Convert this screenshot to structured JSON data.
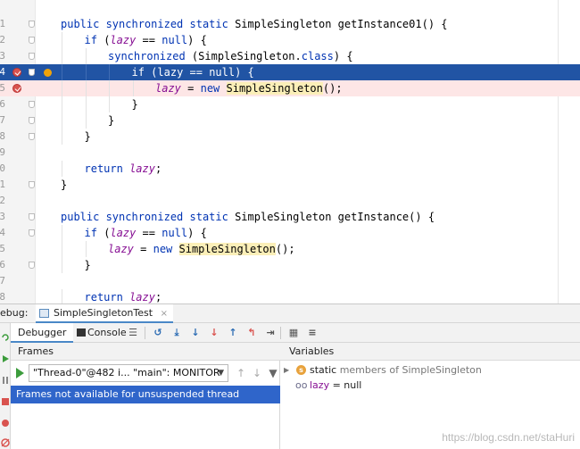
{
  "editor": {
    "lines": [
      {
        "num": "1",
        "tokens": [
          {
            "t": "public ",
            "c": "kw"
          },
          {
            "t": "synchronized ",
            "c": "kw"
          },
          {
            "t": "static ",
            "c": "kw"
          },
          {
            "t": "SimpleSingleton getInstance01() {",
            "c": ""
          }
        ]
      },
      {
        "num": "2",
        "tokens": [
          {
            "t": "if ",
            "c": "kw"
          },
          {
            "t": "(",
            "c": ""
          },
          {
            "t": "lazy",
            "c": "fld"
          },
          {
            "t": " == ",
            "c": ""
          },
          {
            "t": "null",
            "c": "nul"
          },
          {
            "t": ") {",
            "c": ""
          }
        ]
      },
      {
        "num": "3",
        "tokens": [
          {
            "t": "synchronized ",
            "c": "kw"
          },
          {
            "t": "(SimpleSingleton.",
            "c": ""
          },
          {
            "t": "class",
            "c": "kw"
          },
          {
            "t": ") {",
            "c": ""
          }
        ]
      },
      {
        "num": "4",
        "tokens": [
          {
            "t": "if (lazy == null) {",
            "c": ""
          }
        ]
      },
      {
        "num": "5",
        "tokens": [
          {
            "t": "lazy",
            "c": "fld"
          },
          {
            "t": " = ",
            "c": ""
          },
          {
            "t": "new ",
            "c": "kw"
          },
          {
            "t": "SimpleSingleton",
            "c": "cls"
          },
          {
            "t": "();",
            "c": ""
          }
        ]
      },
      {
        "num": "6",
        "tokens": [
          {
            "t": "}",
            "c": ""
          }
        ]
      },
      {
        "num": "7",
        "tokens": [
          {
            "t": "}",
            "c": ""
          }
        ]
      },
      {
        "num": "8",
        "tokens": [
          {
            "t": "}",
            "c": ""
          }
        ]
      },
      {
        "num": "9",
        "tokens": []
      },
      {
        "num": "0",
        "tokens": [
          {
            "t": "return ",
            "c": "kw"
          },
          {
            "t": "lazy",
            "c": "fld"
          },
          {
            "t": ";",
            "c": ""
          }
        ]
      },
      {
        "num": "1",
        "tokens": [
          {
            "t": "}",
            "c": ""
          }
        ]
      },
      {
        "num": "2",
        "tokens": []
      },
      {
        "num": "3",
        "tokens": [
          {
            "t": "public ",
            "c": "kw"
          },
          {
            "t": "synchronized ",
            "c": "kw"
          },
          {
            "t": "static ",
            "c": "kw"
          },
          {
            "t": "SimpleSingleton getInstance() {",
            "c": ""
          }
        ]
      },
      {
        "num": "4",
        "tokens": [
          {
            "t": "if ",
            "c": "kw"
          },
          {
            "t": "(",
            "c": ""
          },
          {
            "t": "lazy",
            "c": "fld"
          },
          {
            "t": " == ",
            "c": ""
          },
          {
            "t": "null",
            "c": "nul"
          },
          {
            "t": ") {",
            "c": ""
          }
        ]
      },
      {
        "num": "5",
        "tokens": [
          {
            "t": "lazy",
            "c": "fld"
          },
          {
            "t": " = ",
            "c": ""
          },
          {
            "t": "new ",
            "c": "kw"
          },
          {
            "t": "SimpleSingleton",
            "c": "cls"
          },
          {
            "t": "();",
            "c": ""
          }
        ]
      },
      {
        "num": "6",
        "tokens": [
          {
            "t": "}",
            "c": ""
          }
        ]
      },
      {
        "num": "7",
        "tokens": []
      },
      {
        "num": "8",
        "tokens": [
          {
            "t": "return ",
            "c": "kw"
          },
          {
            "t": "lazy",
            "c": "fld"
          },
          {
            "t": ";",
            "c": ""
          }
        ]
      }
    ],
    "exec_line_index": 3,
    "breakpoint_line_indices": [
      3,
      4
    ]
  },
  "debug": {
    "label": "ebug:",
    "tab": "SimpleSingletonTest",
    "tab_close": "×",
    "toolbar": {
      "debugger": "Debugger",
      "console": "Console"
    },
    "frames": {
      "title": "Frames",
      "thread": "\"Thread-0\"@482 i... \"main\": MONITOR",
      "message": "Frames not available for unsuspended thread"
    },
    "variables": {
      "title": "Variables",
      "static_prefix": "static",
      "static_rest": " members of SimpleSingleton",
      "var_name": "lazy",
      "var_value": " = null"
    }
  },
  "watermark": "https://blog.csdn.net/staHuri",
  "colors": {
    "exec_line": "#2154a4",
    "breakpoint_line": "#fde6e6",
    "selection": "#2f65ca"
  }
}
